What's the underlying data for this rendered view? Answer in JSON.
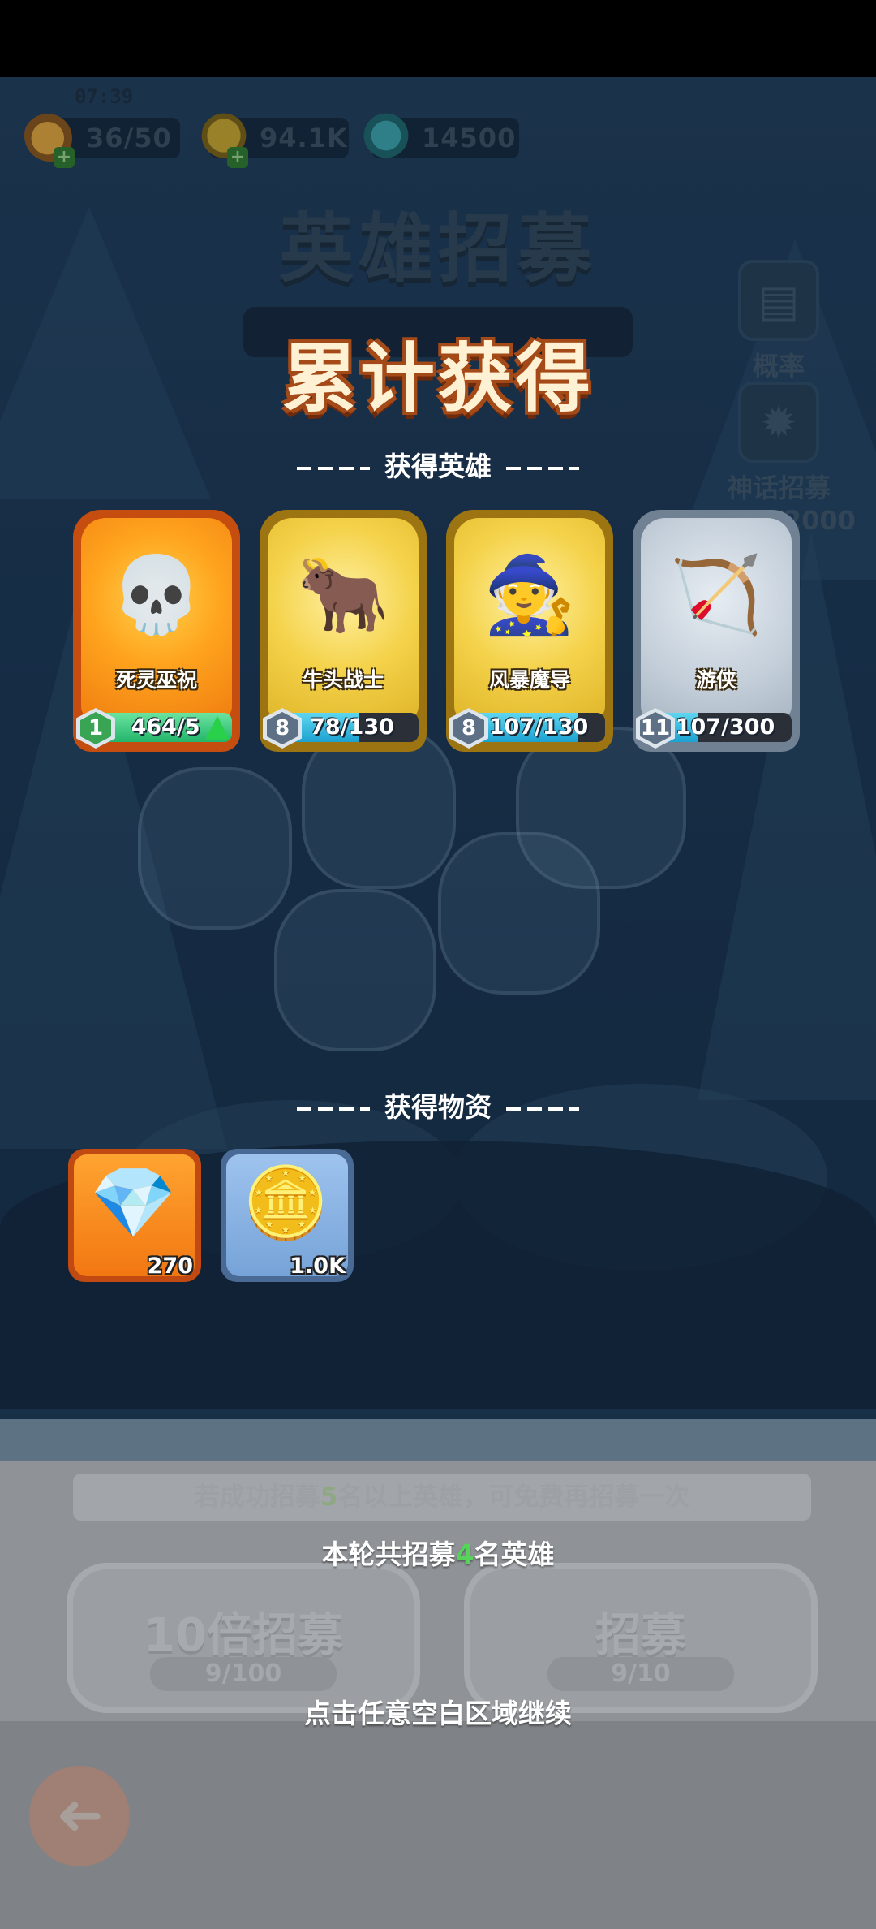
{
  "status": {
    "time": "07:39",
    "stamina": "36/50",
    "gold": "94.1K",
    "gems": "14500"
  },
  "background": {
    "title": "英雄招募",
    "side_buttons": {
      "rate_label": "概率",
      "mythic_label": "神话招募",
      "mythic_progress": "1830/2000"
    }
  },
  "result": {
    "title": "累计获得",
    "heroes_heading": "获得英雄",
    "items_heading": "获得物资",
    "heroes": [
      {
        "name": "死灵巫祝",
        "level": "1",
        "progress": "464/5",
        "fill": 1.0,
        "upgrade": true,
        "rarity": "orange",
        "icon": "necromancer-icon"
      },
      {
        "name": "牛头战士",
        "level": "8",
        "progress": "78/130",
        "fill": 0.6,
        "upgrade": false,
        "rarity": "gold",
        "icon": "minotaur-icon"
      },
      {
        "name": "风暴魔导",
        "level": "8",
        "progress": "107/130",
        "fill": 0.82,
        "upgrade": false,
        "rarity": "gold",
        "icon": "wizard-icon"
      },
      {
        "name": "游侠",
        "level": "11",
        "progress": "107/300",
        "fill": 0.36,
        "upgrade": false,
        "rarity": "grey",
        "icon": "ranger-icon"
      }
    ],
    "items": [
      {
        "qty": "270",
        "icon": "crystal-icon",
        "rarity": "orange"
      },
      {
        "qty": "1.0K",
        "icon": "gold-coin-icon",
        "rarity": "blue"
      }
    ]
  },
  "bottom": {
    "bonus_hint_pre": "若成功招募",
    "bonus_hint_num": "5",
    "bonus_hint_post": "名以上英雄，可免费再招募一次",
    "recruited_pre": "本轮共招募",
    "recruited_num": "4",
    "recruited_post": "名英雄",
    "ten_button": "10倍招募",
    "ten_cost": "9/100",
    "single_button": "招募",
    "single_cost": "9/10",
    "continue_hint": "点击任意空白区域继续"
  },
  "colors": {
    "title_fill": "#fff2d4",
    "title_outline": "#a44a18",
    "highlight_green": "#57d35c"
  }
}
